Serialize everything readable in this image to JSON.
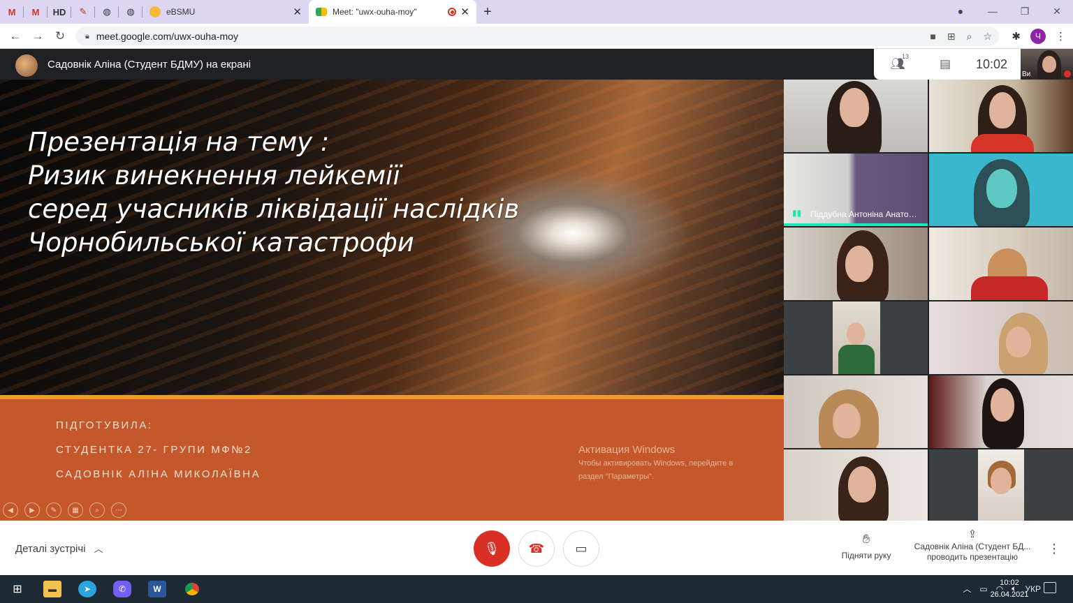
{
  "browser": {
    "pinned_tabs": [
      {
        "icon": "gmail-icon",
        "label": "M"
      },
      {
        "icon": "gmail-icon",
        "label": "M"
      },
      {
        "icon": "hd-icon",
        "label": "HD"
      },
      {
        "icon": "quill-icon",
        "label": ""
      },
      {
        "icon": "globe-icon",
        "label": ""
      },
      {
        "icon": "globe-icon",
        "label": ""
      }
    ],
    "tabs": [
      {
        "title": "eBSMU",
        "active": false
      },
      {
        "title": "Meet: \"uwx-ouha-moy\"",
        "active": true
      }
    ],
    "url": "meet.google.com/uwx-ouha-moy",
    "profile_initial": "Ч"
  },
  "meet": {
    "presenter_banner": "Садовнік Аліна (Студент БДМУ) на екрані",
    "participants_count": "13",
    "time": "10:02",
    "self_label": "Ви",
    "active_speaker": "Піддубна Антоніна Анато…"
  },
  "slide": {
    "title_lines": [
      "Презентація на тему :",
      "Ризик винекнення лейкемії",
      "серед  учасників ліквідації наслідків",
      "Чорнобильської катастрофи"
    ],
    "prepared_label": "ПІДГОТУВИЛА:",
    "group": "СТУДЕНТКА 27- ГРУПИ МФ№2",
    "author": "САДОВНІК АЛІНА МИКОЛАЇВНА",
    "watermark_title": "Активация Windows",
    "watermark_line1": "Чтобы активировать Windows, перейдите в",
    "watermark_line2": "раздел \"Параметры\"."
  },
  "controls": {
    "details": "Деталі зустрічі",
    "raise_hand": "Підняти руку",
    "presenting_name": "Садовнік Аліна (Студент БД...",
    "presenting_status": "проводить презентацію"
  },
  "taskbar": {
    "language": "УКР",
    "time": "10:02",
    "date": "26.04.2021"
  },
  "colors": {
    "slide_orange": "#c4582a",
    "accent_line": "#f29a2e",
    "end_call_red": "#d93025",
    "speaking_teal": "#1de9b6"
  }
}
